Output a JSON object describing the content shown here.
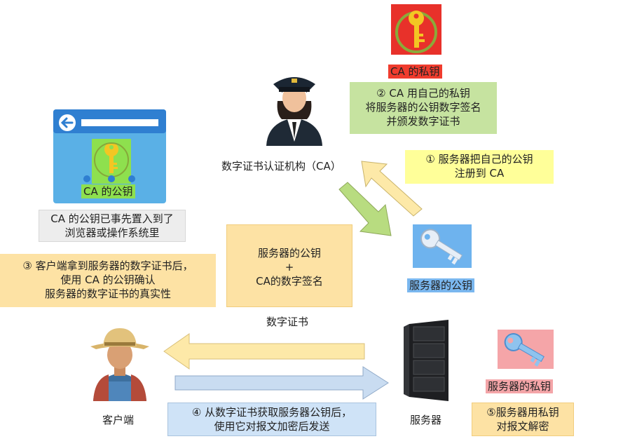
{
  "ca_private_key": {
    "label": "CA 的私钥",
    "icon": "key-icon",
    "bg": "#e8312a",
    "highlight": "#f03c2e"
  },
  "ca_step": {
    "lines": [
      "② CA 用自己的私钥",
      "将服务器的公钥数字签名",
      "并颁发数字证书"
    ],
    "bg": "#c6e3a0"
  },
  "ca_org": {
    "label": "数字证书认证机构（CA）",
    "icon": "officer-icon"
  },
  "browser": {
    "icon": "browser-window-icon",
    "key_label": "CA 的公钥",
    "bg": "#5ab0e6",
    "key_bg": "#8ee04e"
  },
  "browser_note": {
    "lines": [
      "CA 的公钥已事先置入到了",
      "浏览器或操作系统里"
    ],
    "bg": "#ededed"
  },
  "step1": {
    "lines": [
      "① 服务器把自己的公钥",
      "注册到 CA"
    ],
    "bg": "#ffff99"
  },
  "server_public_key": {
    "label": "服务器的公钥",
    "icon": "key-icon",
    "bg": "#6eb3ee",
    "highlight": "#7ab7ef"
  },
  "certificate": {
    "lines": [
      "服务器的公钥",
      "+",
      "CA的数字签名"
    ],
    "caption": "数字证书",
    "bg": "#fde2a4"
  },
  "step3": {
    "lines": [
      "③ 客户端拿到服务器的数字证书后，",
      "使用 CA 的公钥确认",
      "服务器的数字证书的真实性"
    ],
    "bg": "#fde2a4"
  },
  "client": {
    "label": "客户端",
    "icon": "farmer-icon"
  },
  "server": {
    "label": "服务器",
    "icon": "server-rack-icon"
  },
  "server_private_key": {
    "label": "服务器的私钥",
    "icon": "key-icon",
    "bg": "#f5a5a8",
    "highlight": "#f4a5a8"
  },
  "step4": {
    "lines": [
      "④ 从数字证书获取服务器公钥后，",
      "使用它对报文加密后发送"
    ],
    "bg": "#cfe3f7"
  },
  "step5": {
    "lines": [
      "⑤服务器用私钥",
      "对报文解密"
    ],
    "bg": "#fde2a4"
  },
  "colors": {
    "green_arrow": "#b8dc80",
    "yellow_arrow": "#fde9a8",
    "blue_arrow": "#c9dcf1"
  }
}
